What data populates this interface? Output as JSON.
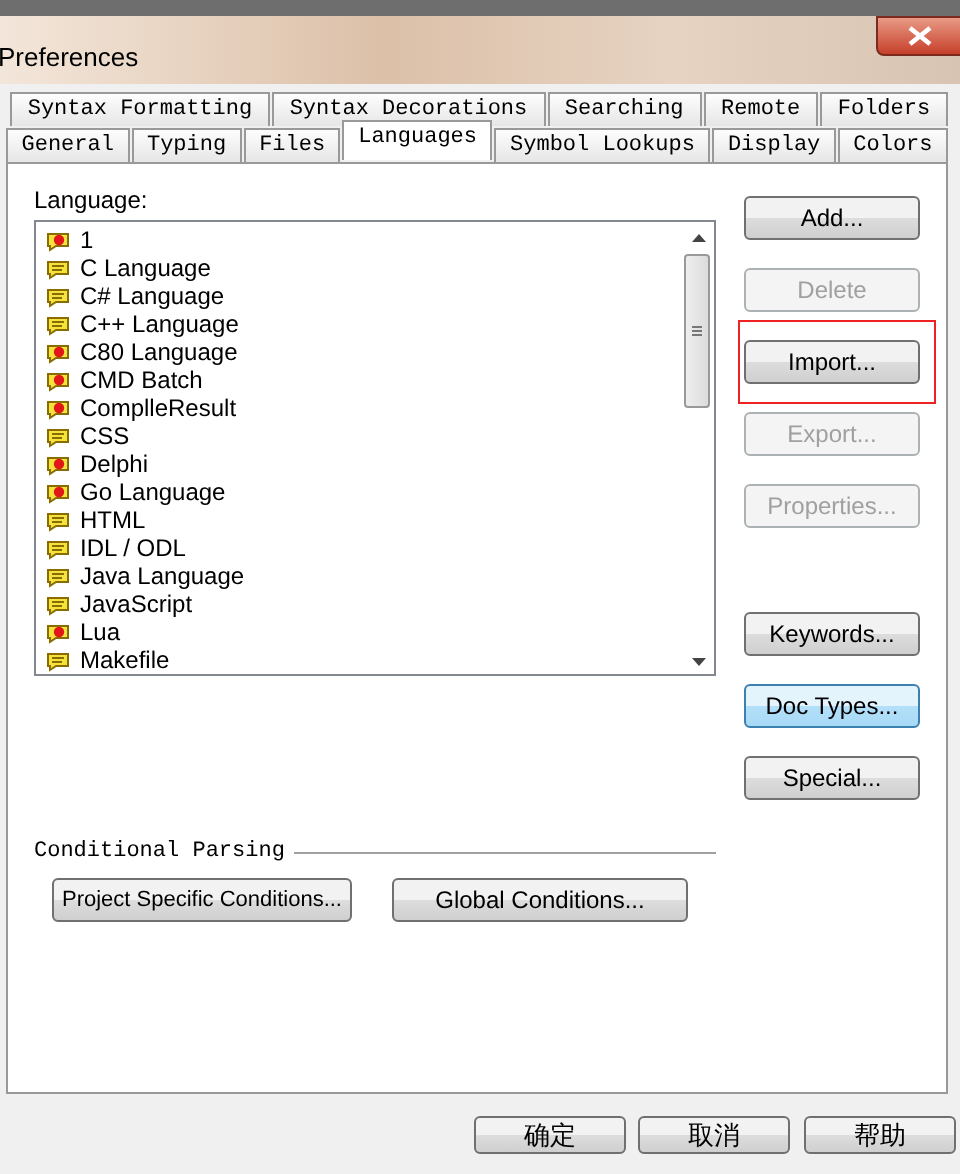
{
  "window": {
    "title": "Preferences"
  },
  "tab_rows": [
    [
      {
        "label": "Syntax Formatting",
        "selected": false
      },
      {
        "label": "Syntax Decorations",
        "selected": false
      },
      {
        "label": "Searching",
        "selected": false
      },
      {
        "label": "Remote",
        "selected": false
      },
      {
        "label": "Folders",
        "selected": false
      }
    ],
    [
      {
        "label": "General",
        "selected": false
      },
      {
        "label": "Typing",
        "selected": false
      },
      {
        "label": "Files",
        "selected": false
      },
      {
        "label": "Languages",
        "selected": true
      },
      {
        "label": "Symbol Lookups",
        "selected": false
      },
      {
        "label": "Display",
        "selected": false
      },
      {
        "label": "Colors",
        "selected": false
      }
    ]
  ],
  "language_list": {
    "label": "Language:",
    "items": [
      {
        "name": "1",
        "kind": "custom"
      },
      {
        "name": "C Language",
        "kind": "builtin"
      },
      {
        "name": "C# Language",
        "kind": "builtin"
      },
      {
        "name": "C++ Language",
        "kind": "builtin"
      },
      {
        "name": "C80 Language",
        "kind": "custom"
      },
      {
        "name": "CMD Batch",
        "kind": "custom"
      },
      {
        "name": "ComplleResult",
        "kind": "custom"
      },
      {
        "name": "CSS",
        "kind": "builtin"
      },
      {
        "name": "Delphi",
        "kind": "custom"
      },
      {
        "name": "Go Language",
        "kind": "custom"
      },
      {
        "name": "HTML",
        "kind": "builtin"
      },
      {
        "name": "IDL / ODL",
        "kind": "builtin"
      },
      {
        "name": "Java Language",
        "kind": "builtin"
      },
      {
        "name": "JavaScript",
        "kind": "builtin"
      },
      {
        "name": "Lua",
        "kind": "custom"
      },
      {
        "name": "Makefile",
        "kind": "builtin"
      }
    ]
  },
  "side_buttons": [
    {
      "kind": "plain",
      "label": "Add...",
      "disabled": false,
      "focused": false
    },
    {
      "kind": "plain",
      "label": "Delete",
      "disabled": true,
      "focused": false
    },
    {
      "kind": "framed",
      "label": "Import...",
      "disabled": false,
      "focused": false
    },
    {
      "kind": "plain",
      "label": "Export...",
      "disabled": true,
      "focused": false
    },
    {
      "kind": "plain",
      "label": "Properties...",
      "disabled": true,
      "focused": false
    }
  ],
  "lower_side_buttons": [
    {
      "label": "Keywords...",
      "disabled": false,
      "focused": false
    },
    {
      "label": "Doc Types...",
      "disabled": false,
      "focused": true
    },
    {
      "label": "Special...",
      "disabled": false,
      "focused": false
    }
  ],
  "conditional_parsing": {
    "title": "Conditional Parsing",
    "buttons": [
      "Project Specific Conditions...",
      "Global Conditions..."
    ]
  },
  "dialog_buttons": [
    "确定",
    "取消",
    "帮助"
  ]
}
